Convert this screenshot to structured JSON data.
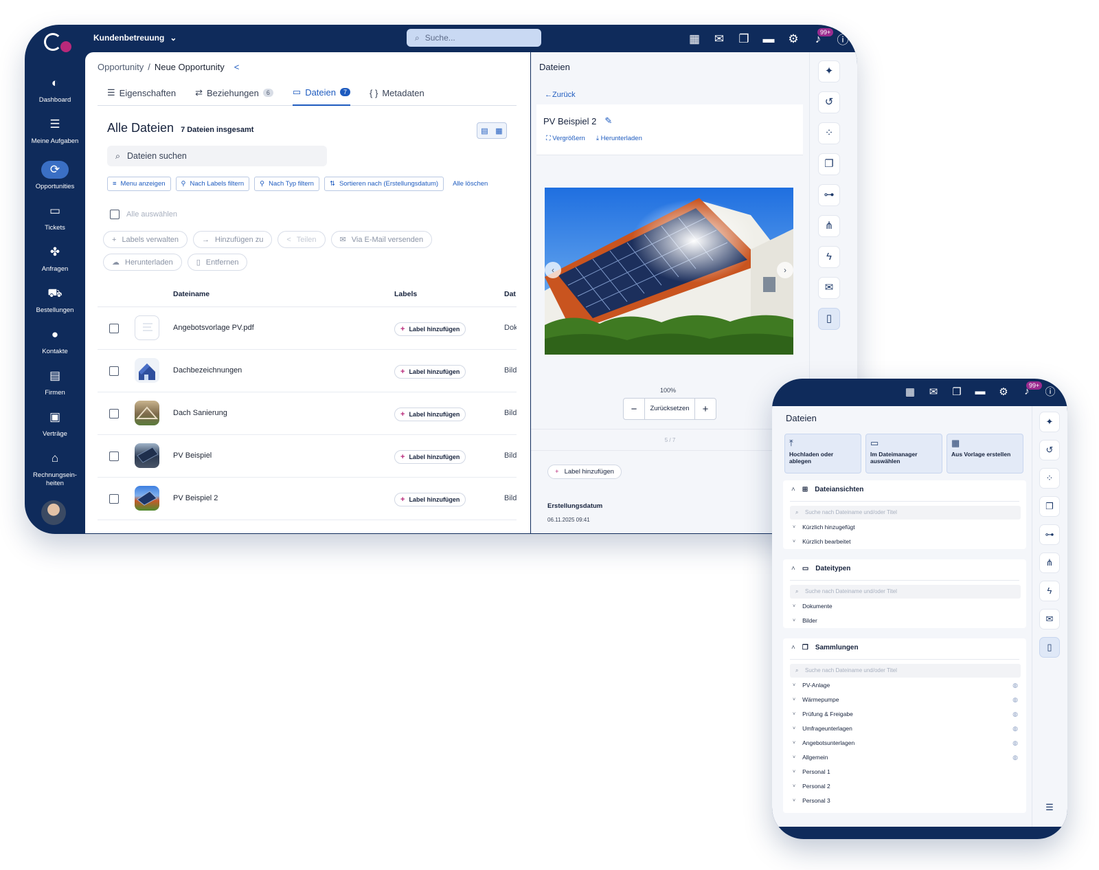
{
  "topbar": {
    "workspace": "Kundenbetreuung",
    "search_placeholder": "Suche...",
    "notifications_badge": "99+"
  },
  "sidebar": {
    "items": [
      {
        "label": "Dashboard",
        "icon": "dashboard-icon"
      },
      {
        "label": "Meine Aufgaben",
        "icon": "tasks-icon"
      },
      {
        "label": "Opportunities",
        "icon": "opportunities-icon"
      },
      {
        "label": "Tickets",
        "icon": "tickets-icon"
      },
      {
        "label": "Anfragen",
        "icon": "requests-icon"
      },
      {
        "label": "Bestellungen",
        "icon": "cart-icon"
      },
      {
        "label": "Kontakte",
        "icon": "person-icon"
      },
      {
        "label": "Firmen",
        "icon": "building-icon"
      },
      {
        "label": "Verträge",
        "icon": "clipboard-icon"
      },
      {
        "label": "Rechnungsein-heiten",
        "icon": "bank-icon"
      }
    ],
    "active": "Opportunities"
  },
  "breadcrumb": {
    "parent": "Opportunity",
    "separator": "/",
    "current": "Neue Opportunity"
  },
  "tabs": [
    {
      "label": "Eigenschaften",
      "count": ""
    },
    {
      "label": "Beziehungen",
      "count": "6"
    },
    {
      "label": "Dateien",
      "count": "7"
    },
    {
      "label": "Metadaten",
      "count": ""
    }
  ],
  "files": {
    "title": "Alle Dateien",
    "total": "7 Dateien insgesamt",
    "search_placeholder": "Dateien suchen",
    "filters": [
      "Menu anzeigen",
      "Nach Labels filtern",
      "Nach Typ filtern",
      "Sortieren nach (Erstellungsdatum)"
    ],
    "clear_all": "Alle löschen",
    "select_all": "Alle auswählen",
    "actions": [
      "Labels verwalten",
      "Hinzufügen zu",
      "Teilen",
      "Via E-Mail versenden",
      "Herunterladen",
      "Entfernen"
    ],
    "columns": {
      "name": "Dateiname",
      "labels": "Labels",
      "type": "Dat"
    },
    "add_label": "Label hinzufügen",
    "rows": [
      {
        "name": "Angebotsvorlage PV.pdf",
        "type": "Dok"
      },
      {
        "name": "Dachbezeichnungen",
        "type": "Bild"
      },
      {
        "name": "Dach Sanierung",
        "type": "Bild"
      },
      {
        "name": "PV Beispiel",
        "type": "Bild"
      },
      {
        "name": "PV Beispiel 2",
        "type": "Bild"
      }
    ]
  },
  "detail": {
    "panel_title": "Dateien",
    "back": "Zurück",
    "file_name": "PV Beispiel 2",
    "enlarge": "Vergrößern",
    "download": "Herunterladen",
    "zoom_level": "100%",
    "reset": "Zurücksetzen",
    "pager": "5 / 7",
    "add_label": "Label hinzufügen",
    "created_label": "Erstellungsdatum",
    "created_value": "06.11.2025 09:41"
  },
  "mobile": {
    "notifications_badge": "99+",
    "title": "Dateien",
    "tiles": [
      "Hochladen oder ablegen",
      "Im Dateimanager auswählen",
      "Aus Vorlage erstellen"
    ],
    "search_placeholder": "Suche nach Dateiname und/oder Titel",
    "sections": [
      {
        "title": "Dateiansichten",
        "items": [
          "Kürzlich hinzugefügt",
          "Kürzlich bearbeitet"
        ]
      },
      {
        "title": "Dateitypen",
        "items": [
          "Dokumente",
          "Bilder"
        ]
      },
      {
        "title": "Sammlungen",
        "items": [
          "PV-Anlage",
          "Wärmepumpe",
          "Prüfung & Freigabe",
          "Umfrageunterlagen",
          "Angebotsunterlagen",
          "Allgemein",
          "Personal 1",
          "Personal 2",
          "Personal 3"
        ]
      }
    ]
  }
}
